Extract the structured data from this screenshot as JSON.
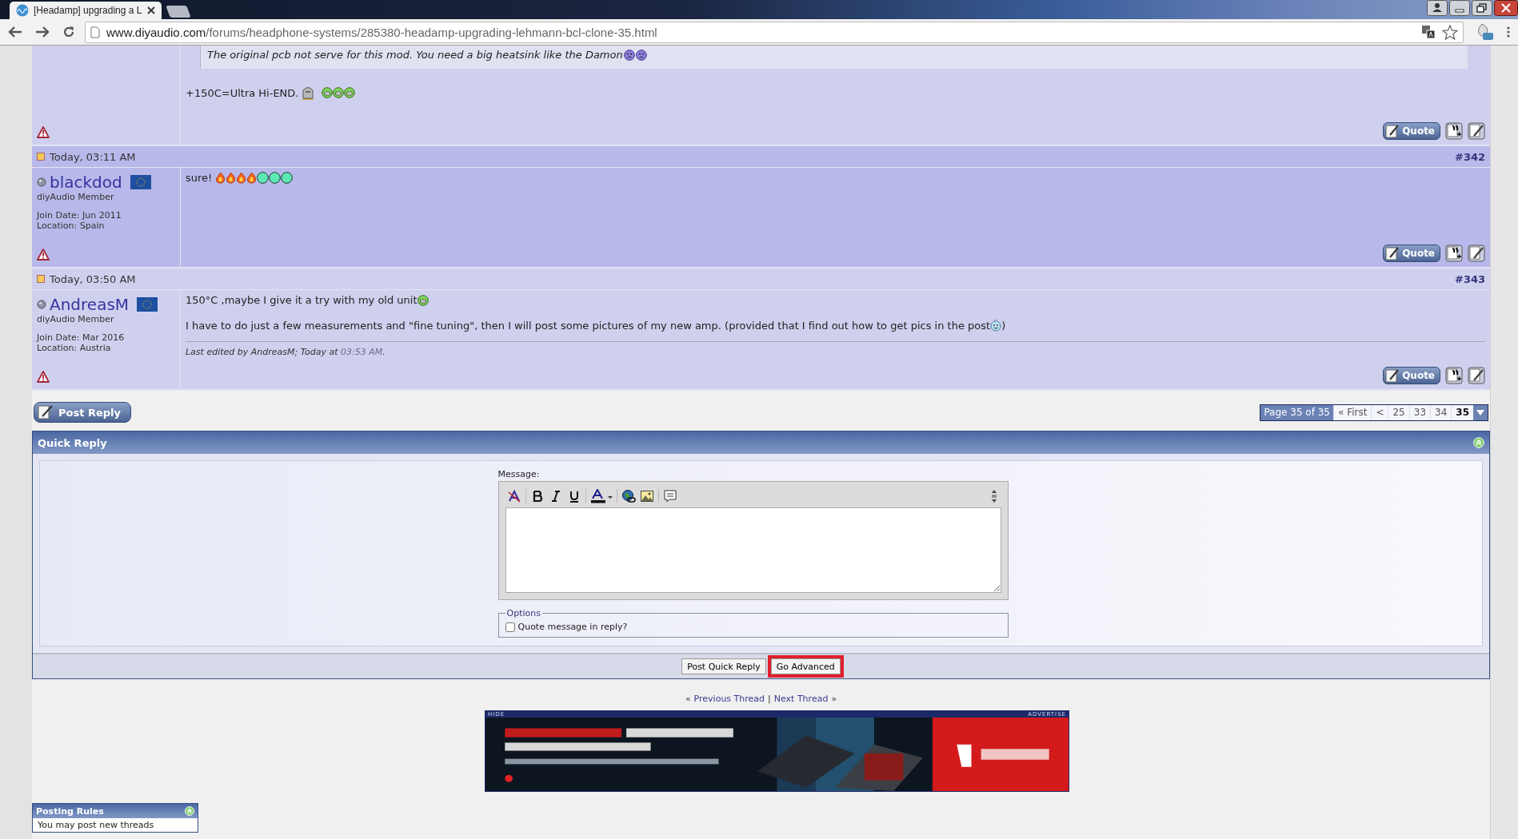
{
  "browser": {
    "tab_title": "[Headamp] upgrading a L",
    "url_host": "www.diyaudio.com",
    "url_path": "/forums/headphone-systems/285380-headamp-upgrading-lehmann-bcl-clone-35.html"
  },
  "posts": [
    {
      "kind": "partial",
      "highlighted": false,
      "quote_button": "Quote",
      "quote": {
        "text": "The original pcb not serve for this mod. You need a big heatsink like the Damon",
        "icons": [
          {
            "kind": "frown"
          },
          {
            "kind": "frown"
          }
        ]
      },
      "lines": [
        {
          "text": "+150C=Ultra Hi-END.",
          "icons": [
            {
              "kind": "tombstone"
            },
            {
              "kind": "space"
            },
            {
              "kind": "grin"
            },
            {
              "kind": "grin"
            },
            {
              "kind": "grin"
            }
          ]
        }
      ]
    },
    {
      "kind": "full",
      "highlighted": true,
      "quote_button": "Quote",
      "date": "Today, 03:11 AM",
      "number": "#342",
      "user": {
        "name": "blackdod",
        "online": false,
        "title": "diyAudio Member",
        "join_date": "Join Date: Jun 2011",
        "location": "Location: Spain"
      },
      "lines": [
        {
          "text": "sure! ",
          "icons": [
            {
              "kind": "flame"
            },
            {
              "kind": "flame"
            },
            {
              "kind": "flame"
            },
            {
              "kind": "flame"
            },
            {
              "kind": "circle"
            },
            {
              "kind": "circle"
            },
            {
              "kind": "circle"
            }
          ]
        }
      ]
    },
    {
      "kind": "full",
      "highlighted": false,
      "quote_button": "Quote",
      "date": "Today, 03:50 AM",
      "number": "#343",
      "user": {
        "name": "AndreasM",
        "online": false,
        "title": "diyAudio Member",
        "join_date": "Join Date: Mar 2016",
        "location": "Location: Austria"
      },
      "lines": [
        {
          "text": "150°C ,maybe I give it a try with my old unit",
          "icons": [
            {
              "kind": "grin"
            }
          ]
        },
        {
          "text": "I have to do just a few measurements and \"fine tuning\", then I will post some pictures of my new amp. (provided that I find out how to get pics in the post",
          "icons": [
            {
              "kind": "smile"
            }
          ],
          "after": ")"
        }
      ],
      "edited": {
        "prefix": "Last edited by AndreasM; Today at ",
        "time": "03:53 AM",
        "suffix": "."
      }
    }
  ],
  "post_reply_button": "Post Reply",
  "pagination": {
    "label": "Page 35 of 35",
    "items": [
      {
        "text": "« First",
        "selected": false
      },
      {
        "text": "<",
        "selected": false
      },
      {
        "text": "25",
        "selected": false
      },
      {
        "text": "33",
        "selected": false
      },
      {
        "text": "34",
        "selected": false
      },
      {
        "text": "35",
        "selected": true
      }
    ]
  },
  "quick_reply": {
    "title": "Quick Reply",
    "message_label": "Message:",
    "options_legend": "Options",
    "quote_option": {
      "label": "Quote message in reply?",
      "checked": false
    },
    "buttons": [
      {
        "label": "Post Quick Reply",
        "highlighted": false
      },
      {
        "label": "Go Advanced",
        "highlighted": true
      }
    ]
  },
  "thread_nav": {
    "prev_mark": "«",
    "prev": "Previous Thread",
    "separator": "|",
    "next": "Next Thread",
    "next_mark": "»"
  },
  "ad": {
    "hide": "HIDE",
    "advertise": "ADVERTISE",
    "kind": "picture"
  },
  "posting_rules": {
    "title": "Posting Rules",
    "text": "You may post new threads"
  }
}
